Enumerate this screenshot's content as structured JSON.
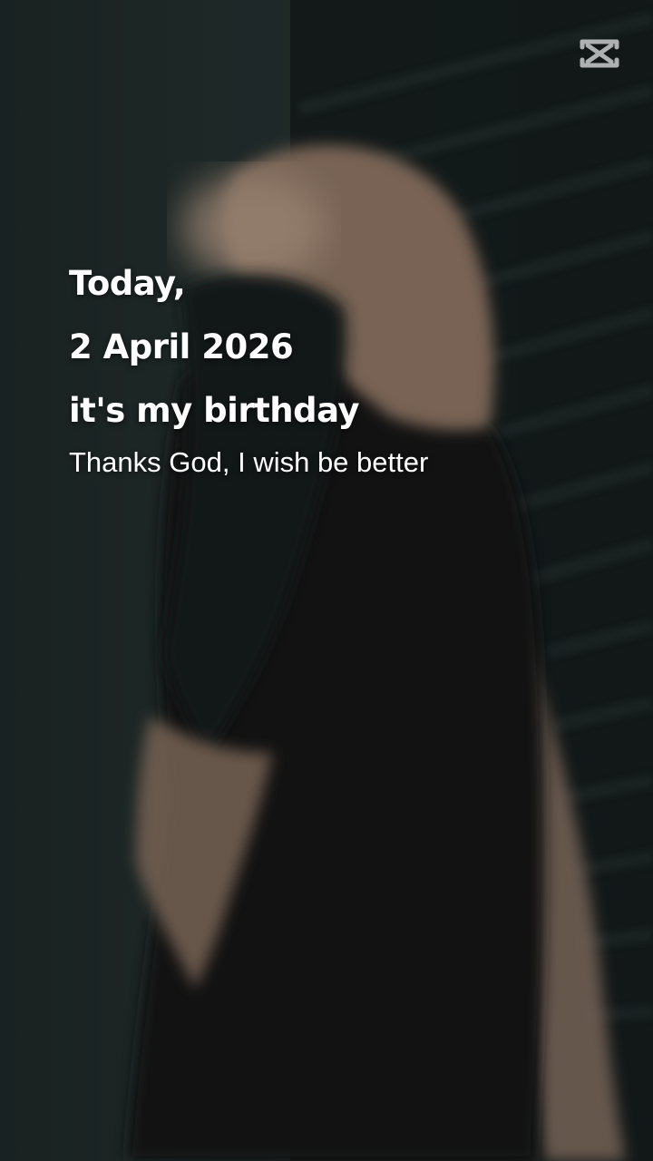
{
  "caption": {
    "line1": "Today,",
    "line2": "2 April 2026",
    "line3": "it's my birthday",
    "line4": "Thanks God, I wish be better"
  },
  "watermark": {
    "icon": "capcut-logo-icon"
  },
  "colors": {
    "background": "#1d2726",
    "text": "#ffffff",
    "hijab": "#8f7766",
    "robe": "#141a1a"
  }
}
